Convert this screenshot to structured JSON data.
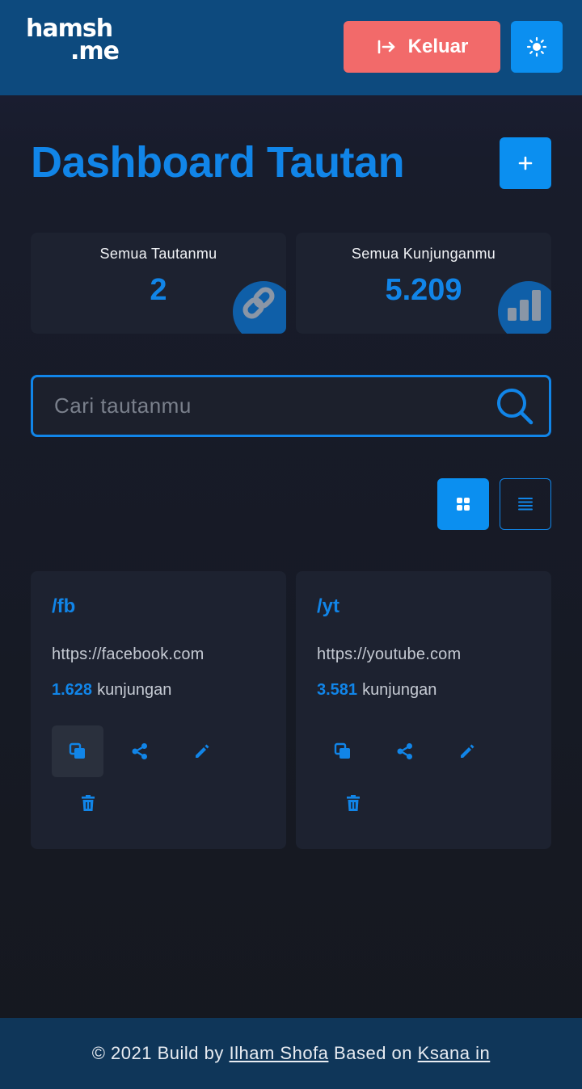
{
  "header": {
    "logo_line1": "hamsh",
    "logo_line2": ".me",
    "logout_label": "Keluar",
    "icons": {
      "logout": "logout-arrow-icon",
      "theme": "sun-icon"
    }
  },
  "main": {
    "title": "Dashboard Tautan",
    "add_icon": "plus-icon",
    "stats": [
      {
        "label": "Semua Tautanmu",
        "value": "2",
        "icon": "link-icon"
      },
      {
        "label": "Semua Kunjunganmu",
        "value": "5.209",
        "icon": "bar-chart-icon"
      }
    ],
    "search": {
      "placeholder": "Cari tautanmu",
      "value": "",
      "icon": "search-icon"
    },
    "view_toggle": {
      "grid_icon": "grid-icon",
      "list_icon": "list-icon",
      "active": "grid"
    },
    "links": [
      {
        "slug": "/fb",
        "url": "https://facebook.com",
        "visits": "1.628",
        "visits_label": "kunjungan"
      },
      {
        "slug": "/yt",
        "url": "https://youtube.com",
        "visits": "3.581",
        "visits_label": "kunjungan"
      }
    ],
    "card_actions": [
      "copy-icon",
      "share-icon",
      "edit-icon",
      "delete-icon"
    ]
  },
  "footer": {
    "prefix": "© 2021 Build by",
    "author": "Ilham Shofa",
    "middle": "Based on",
    "project": "Ksana in"
  },
  "colors": {
    "accent": "#1185e8",
    "header_bg": "#0d4a7e",
    "logout_bg": "#f26a6a",
    "card_bg": "#1d2230",
    "footer_bg": "#0f3659"
  }
}
